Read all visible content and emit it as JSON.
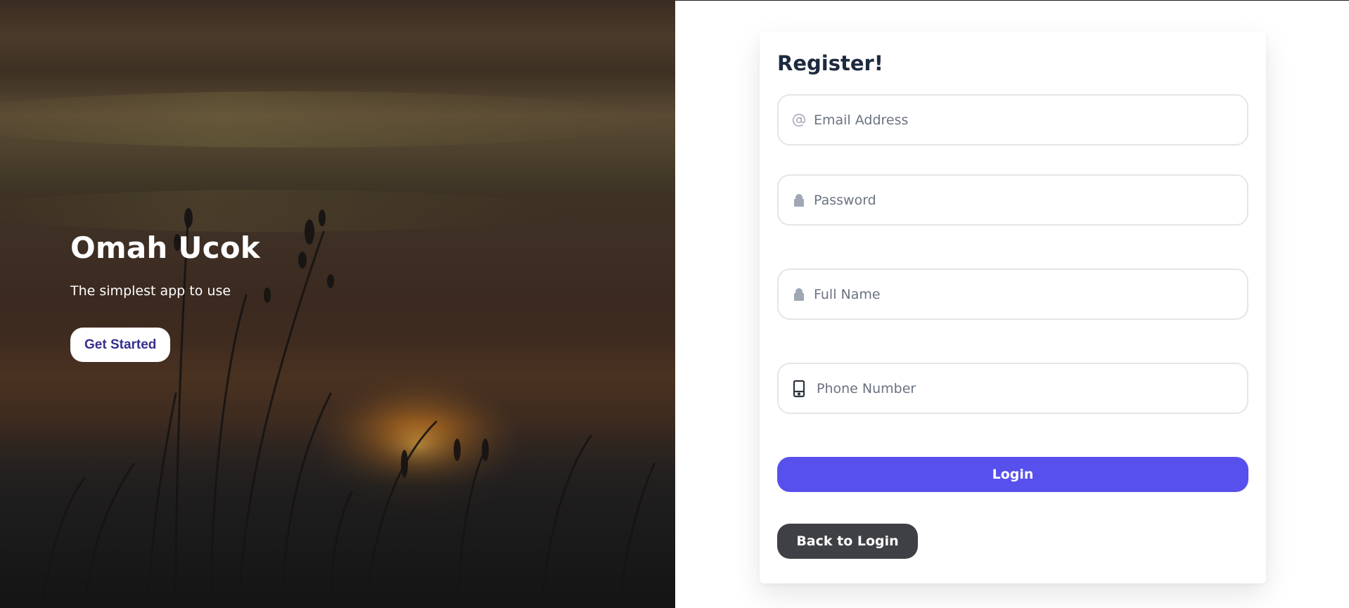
{
  "hero": {
    "title": "Omah Ucok",
    "subtitle": "The simplest app to use",
    "cta_label": "Get Started"
  },
  "form": {
    "title": "Register!",
    "fields": [
      {
        "icon": "at-icon",
        "placeholder": "Email Address",
        "value": ""
      },
      {
        "icon": "lock-icon",
        "placeholder": "Password",
        "value": ""
      },
      {
        "icon": "lock-icon",
        "placeholder": "Full Name",
        "value": ""
      },
      {
        "icon": "phone-icon",
        "placeholder": "Phone Number",
        "value": ""
      }
    ],
    "submit_label": "Login",
    "back_label": "Back to Login"
  },
  "colors": {
    "accent": "#5850ec",
    "cta_text": "#372f8c",
    "dark_button": "#3f4045",
    "title_text": "#1d2a3f"
  }
}
